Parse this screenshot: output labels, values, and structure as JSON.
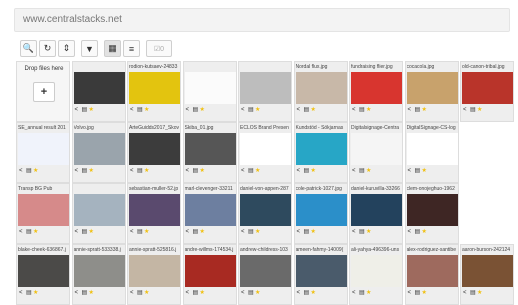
{
  "url": "www.centralstacks.net",
  "toolbar": [
    {
      "name": "search-button",
      "icon": "🔍",
      "gap": false
    },
    {
      "name": "refresh-button",
      "icon": "↻",
      "gap": false
    },
    {
      "name": "sort-button",
      "icon": "⇕",
      "gap": false
    },
    {
      "name": "filter-button",
      "icon": "▼",
      "gap": true
    },
    {
      "name": "grid-view-button",
      "icon": "▦",
      "gap": true
    },
    {
      "name": "list-view-button",
      "icon": "≡",
      "gap": false
    },
    {
      "name": "select-count-button",
      "icon": "☑0",
      "gap": true
    }
  ],
  "drop": {
    "label": "Drop files here",
    "plus": "+"
  },
  "rows": [
    [
      {
        "cap": "",
        "img": "#3a3a3a"
      },
      {
        "cap": "rodion-kutsaev-24833",
        "img": "#e3c40f"
      },
      {
        "cap": "",
        "img": "#fbfbfb"
      },
      {
        "cap": "",
        "img": "#bdbdbd"
      },
      {
        "cap": "Nordal flux.jpg",
        "img": "#c8b8a8"
      },
      {
        "cap": "fundraising flier.jpg",
        "img": "#d8352f"
      },
      {
        "cap": "cocacola.jpg",
        "img": "#c8a26c"
      },
      {
        "cap": "old-canon-tribal.jpg",
        "img": "#b9342a"
      }
    ],
    [
      {
        "cap": "SE_annual result 201",
        "img": "#f0f3fb"
      },
      {
        "cap": "Volvo.jpg",
        "img": "#9aa4ac"
      },
      {
        "cap": "ArteGuidds2017_Skov",
        "img": "#3c3c3c"
      },
      {
        "cap": "Skiba_01.jpg",
        "img": "#565656"
      },
      {
        "cap": "ECLOS Brand Presen",
        "img": "#ffffff"
      },
      {
        "cap": "Kundstöd - Sökjarnas",
        "img": "#27a6c6"
      },
      {
        "cap": "Digitalsignage-Centra",
        "img": "#f5f5f5"
      },
      {
        "cap": "DigitalSignage-CS-log",
        "img": "#ffffff"
      }
    ],
    [
      {
        "cap": "Transp BG Pub",
        "img": "#d68a8a"
      },
      {
        "cap": "",
        "img": "#a5b3bf"
      },
      {
        "cap": "sebastian-muller-52.jp",
        "img": "#5a4a6e"
      },
      {
        "cap": "marl-clevenger-33211",
        "img": "#6d7fa0"
      },
      {
        "cap": "daniel-von-appen-287",
        "img": "#2e4a5e"
      },
      {
        "cap": "cole-patrick-1027.jpg",
        "img": "#2b8fc9"
      },
      {
        "cap": "daniel-kuruvilla-33266",
        "img": "#23425d"
      },
      {
        "cap": "clem-onojeghuo-1962",
        "img": "#3e2624"
      }
    ],
    [
      {
        "cap": "blake-cheek-636867.j",
        "img": "#4b4a48"
      },
      {
        "cap": "annie-spratt-533338.j",
        "img": "#8e8e8a"
      },
      {
        "cap": "annie-spratt-525816.j",
        "img": "#c4b6a4"
      },
      {
        "cap": "andre-willms-174534.j",
        "img": "#a82a22"
      },
      {
        "cap": "andrew-childress-103",
        "img": "#6a6a6a"
      },
      {
        "cap": "ameen-fahmy-14009(",
        "img": "#4a5b6b"
      },
      {
        "cap": "ali-yahya-496396-uns",
        "img": "#efefe8"
      },
      {
        "cap": "alex-rodriguez-santibe",
        "img": "#9e6a5e"
      },
      {
        "cap": "aaron-burson-242124",
        "img": "#7a5234"
      }
    ]
  ]
}
